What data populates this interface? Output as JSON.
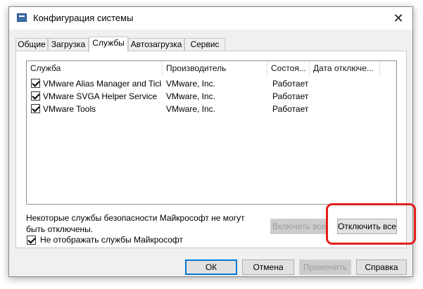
{
  "window": {
    "title": "Конфигурация системы",
    "close_glyph": "✕"
  },
  "tabs": [
    {
      "label": "Общие",
      "active": false
    },
    {
      "label": "Загрузка",
      "active": false
    },
    {
      "label": "Службы",
      "active": true
    },
    {
      "label": "Автозагрузка",
      "active": false
    },
    {
      "label": "Сервис",
      "active": false
    }
  ],
  "services_list": {
    "columns": [
      "Служба",
      "Производитель",
      "Состоя...",
      "Дата отключе..."
    ],
    "rows": [
      {
        "checked": true,
        "name": "VMware Alias Manager and Ticke...",
        "vendor": "VMware, Inc.",
        "status": "Работает",
        "disabled_date": ""
      },
      {
        "checked": true,
        "name": "VMware SVGA Helper Service",
        "vendor": "VMware, Inc.",
        "status": "Работает",
        "disabled_date": ""
      },
      {
        "checked": true,
        "name": "VMware Tools",
        "vendor": "VMware, Inc.",
        "status": "Работает",
        "disabled_date": ""
      }
    ]
  },
  "note": "Некоторые службы безопасности Майкрософт не могут быть отключены.",
  "enable_all_label": "Включить все",
  "disable_all_label": "Отключить все",
  "hide_ms": {
    "checked": true,
    "label": "Не отображать службы Майкрософт"
  },
  "footer": {
    "ok": "ОК",
    "cancel": "Отмена",
    "apply": "Применить",
    "help": "Справка"
  },
  "colors": {
    "highlight": "#e0201b",
    "accent": "#0078d7"
  }
}
